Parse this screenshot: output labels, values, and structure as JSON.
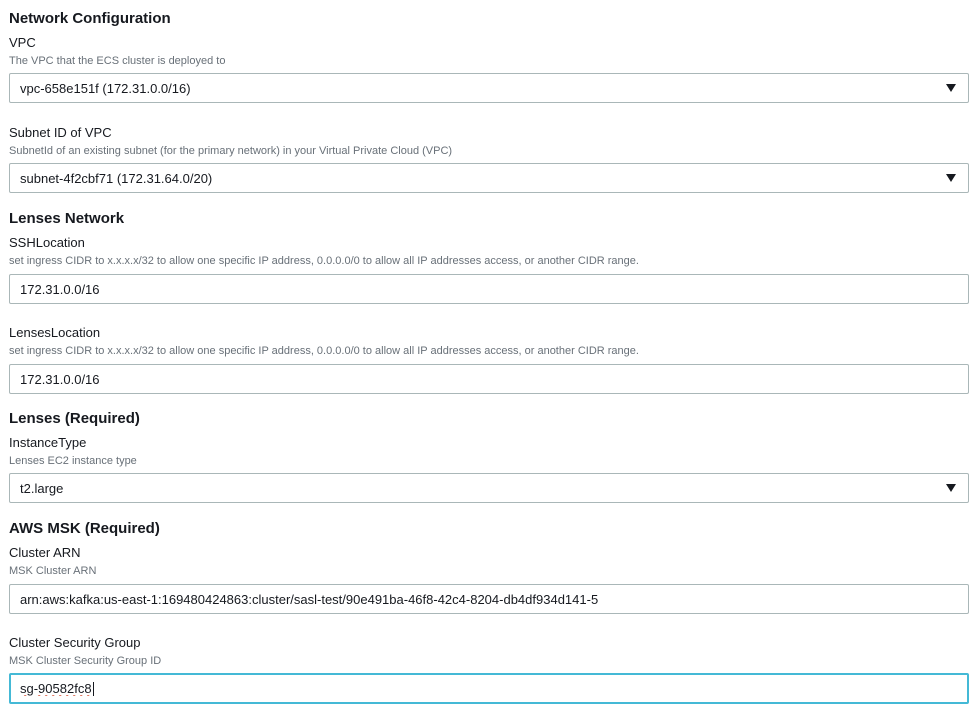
{
  "sections": {
    "network": "Network Configuration",
    "lenses_network": "Lenses Network",
    "lenses": "Lenses (Required)",
    "msk": "AWS MSK (Required)"
  },
  "fields": {
    "vpc": {
      "label": "VPC",
      "description": "The VPC that the ECS cluster is deployed to",
      "value": "vpc-658e151f (172.31.0.0/16)"
    },
    "subnet": {
      "label": "Subnet ID of VPC",
      "description": "SubnetId of an existing subnet (for the primary network) in your Virtual Private Cloud (VPC)",
      "value": "subnet-4f2cbf71 (172.31.64.0/20)"
    },
    "ssh_location": {
      "label": "SSHLocation",
      "description": "set ingress CIDR to x.x.x.x/32 to allow one specific IP address, 0.0.0.0/0 to allow all IP addresses access, or another CIDR range.",
      "value": "172.31.0.0/16"
    },
    "lenses_location": {
      "label": "LensesLocation",
      "description": "set ingress CIDR to x.x.x.x/32 to allow one specific IP address, 0.0.0.0/0 to allow all IP addresses access, or another CIDR range.",
      "value": "172.31.0.0/16"
    },
    "instance_type": {
      "label": "InstanceType",
      "description": "Lenses EC2 instance type",
      "value": "t2.large"
    },
    "cluster_arn": {
      "label": "Cluster ARN",
      "description": "MSK Cluster ARN",
      "value": "arn:aws:kafka:us-east-1:169480424863:cluster/sasl-test/90e491ba-46f8-42c4-8204-db4df934d141-5"
    },
    "security_group": {
      "label": "Cluster Security Group",
      "description": "MSK Cluster Security Group ID",
      "value": "sg-90582fc8"
    }
  },
  "icons": {
    "dropdown": "caret-down-icon"
  },
  "colors": {
    "focus_border": "#44b9d6",
    "input_border": "#aab7b8",
    "description": "#687078"
  }
}
